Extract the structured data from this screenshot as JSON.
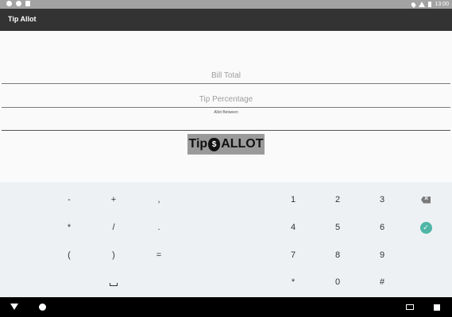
{
  "status_bar": {
    "time": "13:00"
  },
  "app": {
    "title": "Tip Allot"
  },
  "form": {
    "bill_total": {
      "placeholder": "Bill Total",
      "value": ""
    },
    "tip_percentage": {
      "placeholder": "Tip Percentage",
      "value": ""
    },
    "allot_between": {
      "label": "Allot Between",
      "value": ""
    }
  },
  "logo": {
    "text_left": "Tip",
    "icon_glyph": "$",
    "text_right": "ALLOT"
  },
  "keyboard": {
    "rows": [
      [
        "-",
        "+",
        ",",
        "1",
        "2",
        "3"
      ],
      [
        "*",
        "/",
        ".",
        "4",
        "5",
        "6"
      ],
      [
        "(",
        ")",
        "=",
        "7",
        "8",
        "9"
      ],
      [
        "",
        "",
        "",
        "*",
        "0",
        "#"
      ]
    ],
    "check_glyph": "✓"
  }
}
